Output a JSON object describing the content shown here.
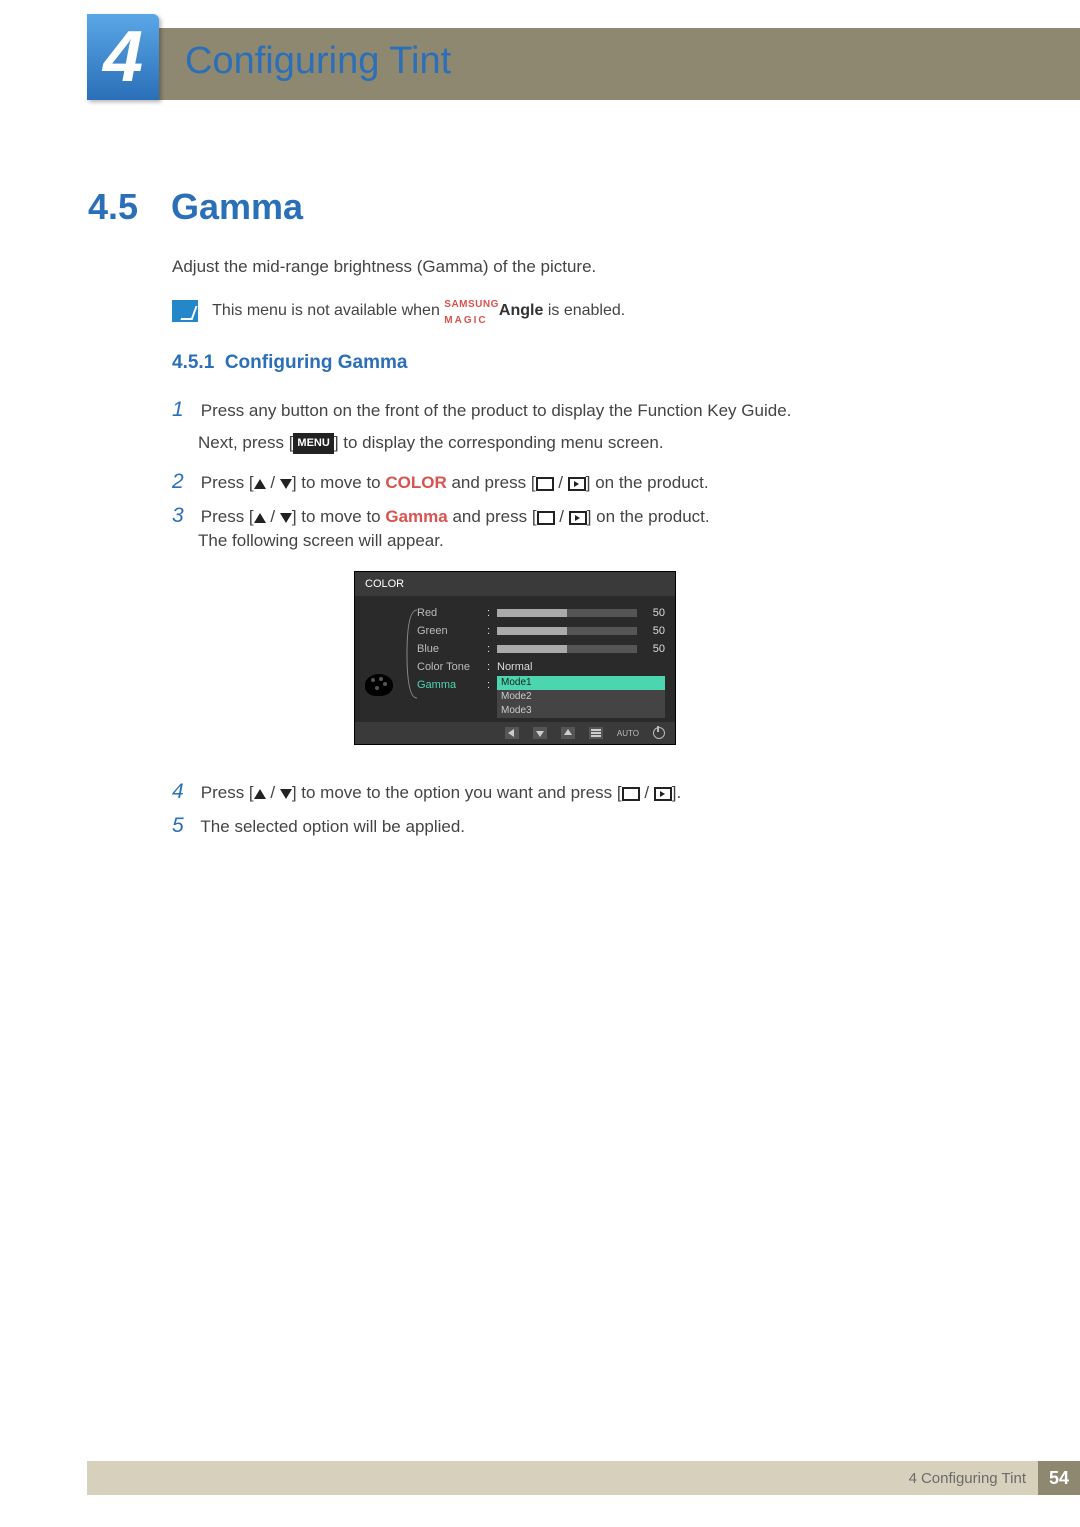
{
  "chapter": {
    "number": "4",
    "title": "Configuring Tint"
  },
  "section": {
    "num": "4.5",
    "title": "Gamma"
  },
  "intro": "Adjust the mid-range brightness (Gamma) of the picture.",
  "note": {
    "pre": "This menu is not available when ",
    "brand_top": "SAMSUNG",
    "brand_bot": "MAGIC",
    "brand_word": "Angle",
    "post": " is enabled."
  },
  "subsection": {
    "num": "4.5.1",
    "title": "Configuring Gamma"
  },
  "steps": {
    "s1a": "Press any button on the front of the product to display the Function Key Guide.",
    "s1b_pre": "Next, press [",
    "menu": "MENU",
    "s1b_post": "] to display the corresponding menu screen.",
    "s2_pre": "Press [",
    "s2_mid": "] to move to ",
    "color": "COLOR",
    "s2_post": " and press [",
    "s2_end": "] on the product.",
    "s3_pre": "Press [",
    "s3_mid": "] to move to ",
    "gamma": "Gamma",
    "s3_post": " and press [",
    "s3_end": "] on the product.",
    "s3_b": "The following screen will appear.",
    "s4_pre": "Press [",
    "s4_mid": "] to move to the option you want and press [",
    "s4_end": "].",
    "s5": "The selected option will be applied."
  },
  "osd": {
    "title": "COLOR",
    "items": {
      "red": {
        "label": "Red",
        "value": "50"
      },
      "green": {
        "label": "Green",
        "value": "50"
      },
      "blue": {
        "label": "Blue",
        "value": "50"
      },
      "colortone": {
        "label": "Color Tone",
        "value": "Normal"
      },
      "gamma": {
        "label": "Gamma"
      }
    },
    "modes": [
      "Mode1",
      "Mode2",
      "Mode3"
    ],
    "auto": "AUTO"
  },
  "footer": {
    "num": "4",
    "label": "Configuring Tint",
    "page": "54"
  }
}
